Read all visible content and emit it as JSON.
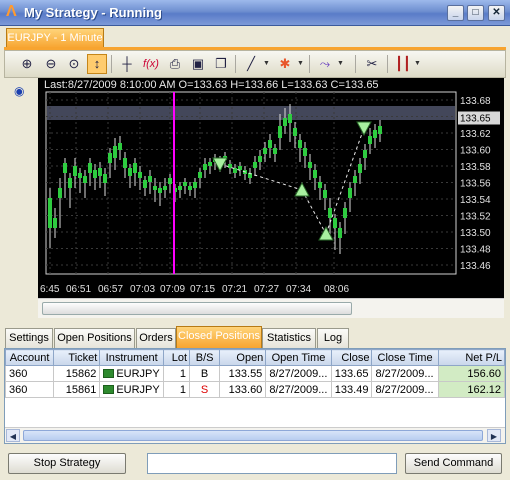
{
  "window": {
    "title": "My Strategy - Running",
    "minimize_glyph": "_",
    "maximize_glyph": "□",
    "close_glyph": "✕"
  },
  "document_tab": {
    "label": "EURJPY - 1 Minute"
  },
  "toolbar": {
    "items": [
      "zoom-in-icon",
      "zoom-out-icon",
      "zoom-reset-icon",
      "cursor-icon",
      "crosshair-icon",
      "indicator-icon",
      "print-icon",
      "save-icon",
      "copy-icon",
      "line-tool-icon",
      "marker-tool-icon",
      "pattern-tool-icon",
      "settings-icon",
      "candles-icon"
    ]
  },
  "chart": {
    "info": "Last:8/27/2009 8:10:00 AM O=133.63 H=133.66 L=133.63 C=133.65",
    "price_labels": [
      "133.68",
      "133.65",
      "133.62",
      "133.60",
      "133.58",
      "133.56",
      "133.54",
      "133.52",
      "133.50",
      "133.48",
      "133.46"
    ],
    "current_price": "133.65",
    "time_labels": [
      "6:45",
      "06:51",
      "06:57",
      "07:03",
      "07:09",
      "07:15",
      "07:21",
      "07:27",
      "07:34",
      "08:06"
    ],
    "colors": {
      "background": "#000000",
      "grid": "#3a3a3a",
      "up_candle": "#2ecc40",
      "down_candle": "#ff3b3b",
      "cursor_line": "#ff00ff",
      "signal_marker": "#a8f0a0"
    }
  },
  "tabs": [
    "Settings",
    "Open Positions",
    "Orders",
    "Closed Positions",
    "Statistics",
    "Log"
  ],
  "selected_tab": "Closed Positions",
  "positions_table": {
    "columns": [
      "Account",
      "Ticket",
      "Instrument",
      "Lot",
      "B/S",
      "Open",
      "Open Time",
      "Close",
      "Close Time",
      "Net P/L"
    ],
    "rows": [
      {
        "account": "360",
        "ticket": "15862",
        "instrument": "EURJPY",
        "lot": "1",
        "side": "B",
        "open": "133.55",
        "open_time": "8/27/2009...",
        "close": "133.65",
        "close_time": "8/27/2009...",
        "net_pl": "156.60"
      },
      {
        "account": "360",
        "ticket": "15861",
        "instrument": "EURJPY",
        "lot": "1",
        "side": "S",
        "open": "133.60",
        "open_time": "8/27/2009...",
        "close": "133.49",
        "close_time": "8/27/2009...",
        "net_pl": "162.12"
      }
    ]
  },
  "buttons": {
    "stop": "Stop Strategy",
    "send": "Send Command"
  },
  "command_input": {
    "value": "",
    "placeholder": ""
  }
}
